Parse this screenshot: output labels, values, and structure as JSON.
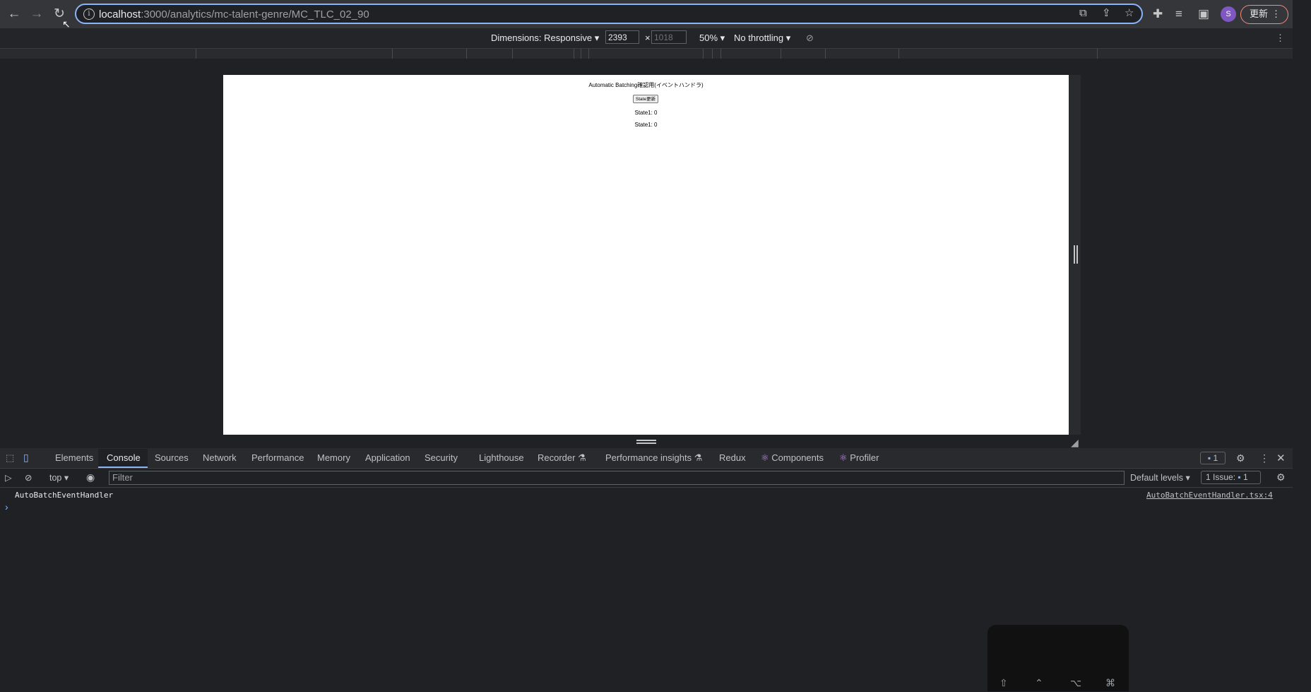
{
  "browser": {
    "url_host": "localhost",
    "url_path": ":3000/analytics/mc-talent-genre/MC_TLC_02_90",
    "avatar_letter": "S",
    "update_label": "更新"
  },
  "device_toolbar": {
    "dimensions_label": "Dimensions: Responsive",
    "width": "2393",
    "height": "1018",
    "zoom": "50%",
    "throttling": "No throttling"
  },
  "page": {
    "title": "Automatic Batching確認用(イベントハンドラ)",
    "button_label": "State更新",
    "state1_line_a": "State1: 0",
    "state1_line_b": "State1: 0"
  },
  "devtools": {
    "tabs": [
      "Elements",
      "Console",
      "Sources",
      "Network",
      "Performance",
      "Memory",
      "Application",
      "Security",
      "Lighthouse",
      "Recorder",
      "Performance insights",
      "Redux",
      "Components",
      "Profiler"
    ],
    "active_tab": "Console",
    "message_count": "1",
    "context": "top",
    "filter_placeholder": "Filter",
    "levels": "Default levels",
    "issues_label": "1 Issue:",
    "issues_count": "1",
    "log_message": "AutoBatchEventHandler",
    "log_source": "AutoBatchEventHandler.tsx:4",
    "prompt": "›"
  },
  "keyboard_overlay": {
    "keys": [
      "⇧",
      "⌃",
      "⌥",
      "⌘"
    ]
  }
}
